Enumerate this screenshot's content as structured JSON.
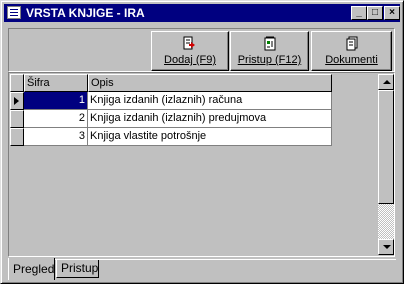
{
  "window": {
    "title": "VRSTA KNJIGE - IRA"
  },
  "titlebar_buttons": {
    "minimize": "_",
    "maximize": "□",
    "close": "×"
  },
  "toolbar": {
    "add_label": "Dodaj (F9)",
    "access_label": "Pristup (F12)",
    "documents_label": "Dokumenti"
  },
  "grid": {
    "columns": [
      "Šifra",
      "Opis"
    ],
    "rows": [
      {
        "sifra": "1",
        "opis": "Knjiga izdanih (izlaznih) računa"
      },
      {
        "sifra": "2",
        "opis": "Knjiga izdanih (izlaznih) predujmova"
      },
      {
        "sifra": "3",
        "opis": "Knjiga vlastite potrošnje"
      }
    ],
    "selected_row": 1
  },
  "tabs": [
    {
      "label": "Pregled",
      "active": true
    },
    {
      "label": "Pristup",
      "active": false
    }
  ],
  "colors": {
    "titlebar": "#000080",
    "selection": "#000080",
    "face": "#c0c0c0"
  },
  "icons": [
    "app-icon",
    "add-record-icon",
    "access-icon",
    "documents-icon",
    "row-pointer-icon"
  ]
}
